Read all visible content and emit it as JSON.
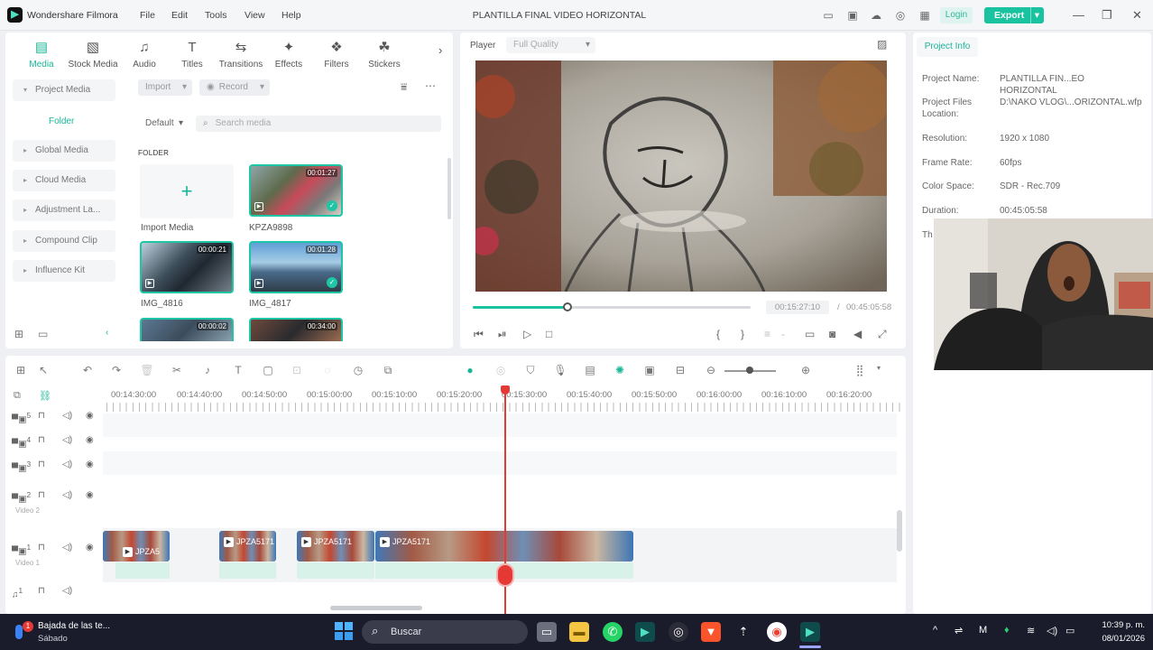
{
  "app": {
    "name": "Wondershare Filmora",
    "menu": [
      "File",
      "Edit",
      "Tools",
      "View",
      "Help"
    ],
    "window_title": "PLANTILLA FINAL VIDEO HORIZONTAL",
    "login": "Login",
    "export": "Export"
  },
  "media_tabs": [
    {
      "label": "Media",
      "icon": "media-icon",
      "active": true
    },
    {
      "label": "Stock Media",
      "icon": "stock-media-icon"
    },
    {
      "label": "Audio",
      "icon": "music-note-icon"
    },
    {
      "label": "Titles",
      "icon": "titles-icon"
    },
    {
      "label": "Transitions",
      "icon": "transitions-icon"
    },
    {
      "label": "Effects",
      "icon": "effects-icon"
    },
    {
      "label": "Filters",
      "icon": "filters-icon"
    },
    {
      "label": "Stickers",
      "icon": "stickers-icon"
    }
  ],
  "sidebar": {
    "items": [
      "Project Media",
      "Global Media",
      "Cloud Media",
      "Adjustment La...",
      "Compound Clip",
      "Influence Kit"
    ],
    "folder": "Folder"
  },
  "media_toolbar": {
    "import": "Import",
    "record": "Record",
    "sort": "Default",
    "search_placeholder": "Search media",
    "folder_heading": "FOLDER"
  },
  "media_items": [
    {
      "name": "Import Media",
      "duration": ""
    },
    {
      "name": "KPZA9898",
      "duration": "00:01:27"
    },
    {
      "name": "IMG_4816",
      "duration": "00:00:21"
    },
    {
      "name": "IMG_4817",
      "duration": "00:01:28"
    },
    {
      "name": "",
      "duration": "00:00:02"
    },
    {
      "name": "",
      "duration": "00:34:00"
    }
  ],
  "player": {
    "label": "Player",
    "quality": "Full Quality",
    "current_time": "00:15:27:10",
    "separator": "/",
    "total_time": "00:45:05:58",
    "progress": 0.34
  },
  "project_info": {
    "tab": "Project Info",
    "rows": [
      {
        "key": "Project Name:",
        "value": "PLANTILLA FIN...EO HORIZONTAL"
      },
      {
        "key": "Project Files Location:",
        "value": "D:\\NAKO VLOG\\...ORIZONTAL.wfp"
      },
      {
        "key": "Resolution:",
        "value": "1920 x 1080"
      },
      {
        "key": "Frame Rate:",
        "value": "60fps"
      },
      {
        "key": "Color Space:",
        "value": "SDR - Rec.709"
      },
      {
        "key": "Duration:",
        "value": "00:45:05:58"
      },
      {
        "key": "Th",
        "value": ""
      }
    ]
  },
  "timeline": {
    "ruler": [
      "00:14:30:00",
      "00:14:40:00",
      "00:14:50:00",
      "00:15:00:00",
      "00:15:10:00",
      "00:15:20:00",
      "00:15:30:00",
      "00:15:40:00",
      "00:15:50:00",
      "00:16:00:00",
      "00:16:10:00",
      "00:16:20:00"
    ],
    "tracks": [
      {
        "num": "5",
        "name": ""
      },
      {
        "num": "4",
        "name": ""
      },
      {
        "num": "3",
        "name": ""
      },
      {
        "num": "2",
        "name": "Video 2"
      },
      {
        "num": "1",
        "name": "Video 1"
      },
      {
        "num": "1",
        "name": ""
      }
    ],
    "clips": [
      "JPZA5",
      "JPZA5171",
      "JPZA5171",
      "JPZA5171"
    ]
  },
  "taskbar": {
    "weather_title": "Bajada de las te...",
    "weather_sub": "Sábado",
    "weather_badge": "1",
    "search": "Buscar",
    "time": "10:39 p. m.",
    "date": "08/01/2026"
  },
  "colors": {
    "accent": "#19c3a0",
    "playhead": "#e53935",
    "taskbar": "#1b1c2b"
  }
}
